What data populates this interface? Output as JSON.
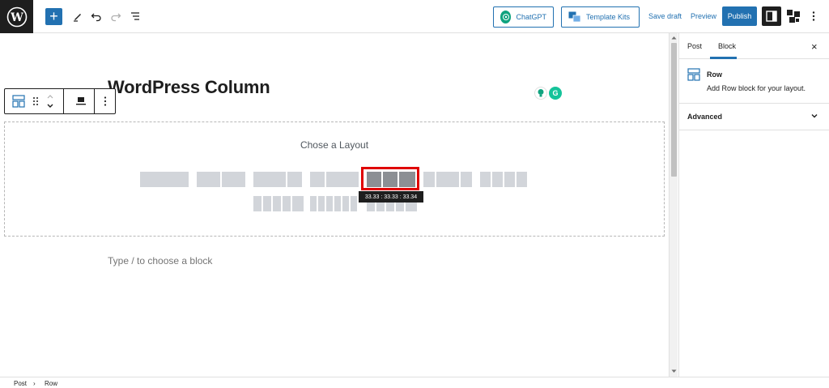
{
  "toolbar": {
    "add_label": "+",
    "chatgpt_label": "ChatGPT",
    "template_kits_label": "Template Kits",
    "save_draft_label": "Save draft",
    "preview_label": "Preview",
    "publish_label": "Publish"
  },
  "editor": {
    "post_title": "WordPress Column",
    "layout_title": "Chose a Layout",
    "selected_layout_tooltip": "33.33 : 33.33 : 33.34",
    "placeholder": "Type / to choose a block",
    "grammarly_letter": "G"
  },
  "sidebar": {
    "tabs": [
      "Post",
      "Block"
    ],
    "active_tab": "Block",
    "close_icon": "×",
    "block_name": "Row",
    "block_description": "Add Row block for your layout.",
    "advanced_label": "Advanced"
  },
  "breadcrumb": {
    "items": [
      "Post",
      "Row"
    ],
    "separator": "›"
  },
  "colors": {
    "accent": "#2271b1",
    "selection": "#e00000",
    "layout_cell": "#d2d5da",
    "layout_cell_selected": "#8c8f94"
  }
}
